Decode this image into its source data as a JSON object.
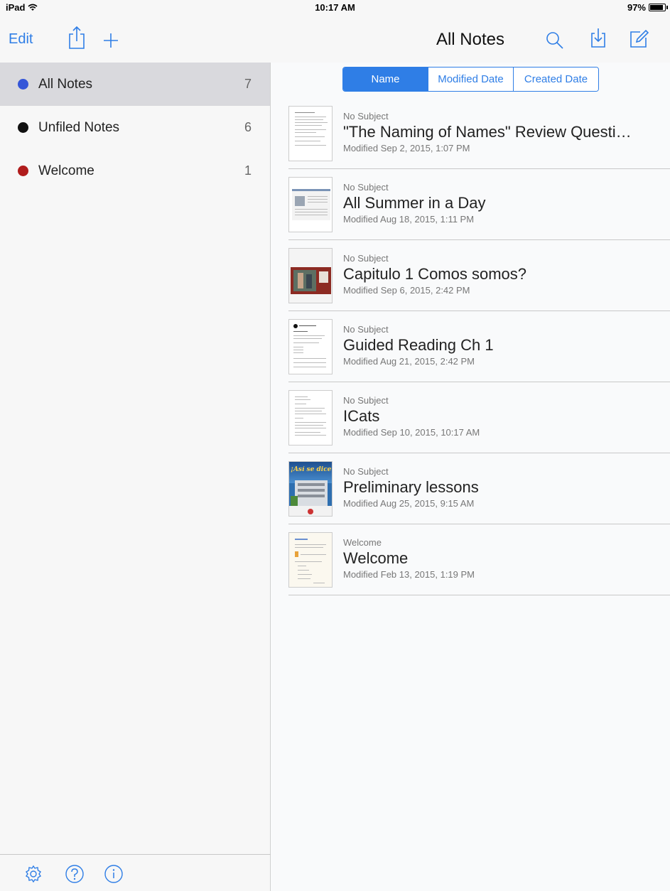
{
  "status_bar": {
    "device": "iPad",
    "time": "10:17 AM",
    "battery": "97%"
  },
  "nav": {
    "edit_label": "Edit",
    "title": "All Notes",
    "accent": "#2f7ee6"
  },
  "sidebar": {
    "items": [
      {
        "label": "All Notes",
        "count": "7",
        "color": "#3556d8"
      },
      {
        "label": "Unfiled Notes",
        "count": "6",
        "color": "#111111"
      },
      {
        "label": "Welcome",
        "count": "1",
        "color": "#b01c1c"
      }
    ],
    "footer_icons": [
      "settings-icon",
      "help-icon",
      "info-icon"
    ]
  },
  "sort": {
    "options": [
      "Name",
      "Modified Date",
      "Created Date"
    ],
    "selected": "Name"
  },
  "notes": [
    {
      "subject": "No Subject",
      "title": "\"The Naming of Names\" Review Questi…",
      "modified": "Modified Sep 2, 2015, 1:07 PM"
    },
    {
      "subject": "No Subject",
      "title": "All Summer in a Day",
      "modified": "Modified Aug 18, 2015, 1:11 PM"
    },
    {
      "subject": "No Subject",
      "title": "Capitulo 1 Comos somos?",
      "modified": "Modified Sep 6, 2015, 2:42 PM"
    },
    {
      "subject": "No Subject",
      "title": "Guided Reading Ch 1",
      "modified": "Modified Aug 21, 2015, 2:42 PM"
    },
    {
      "subject": "No Subject",
      "title": "ICats",
      "modified": "Modified Sep 10, 2015, 10:17 AM"
    },
    {
      "subject": "No Subject",
      "title": "Preliminary lessons",
      "modified": "Modified Aug 25, 2015, 9:15 AM"
    },
    {
      "subject": "Welcome",
      "title": "Welcome",
      "modified": "Modified Feb 13, 2015, 1:19 PM"
    }
  ],
  "thumbnails": {
    "preliminary_cover_text": "¡Así se dice!"
  }
}
